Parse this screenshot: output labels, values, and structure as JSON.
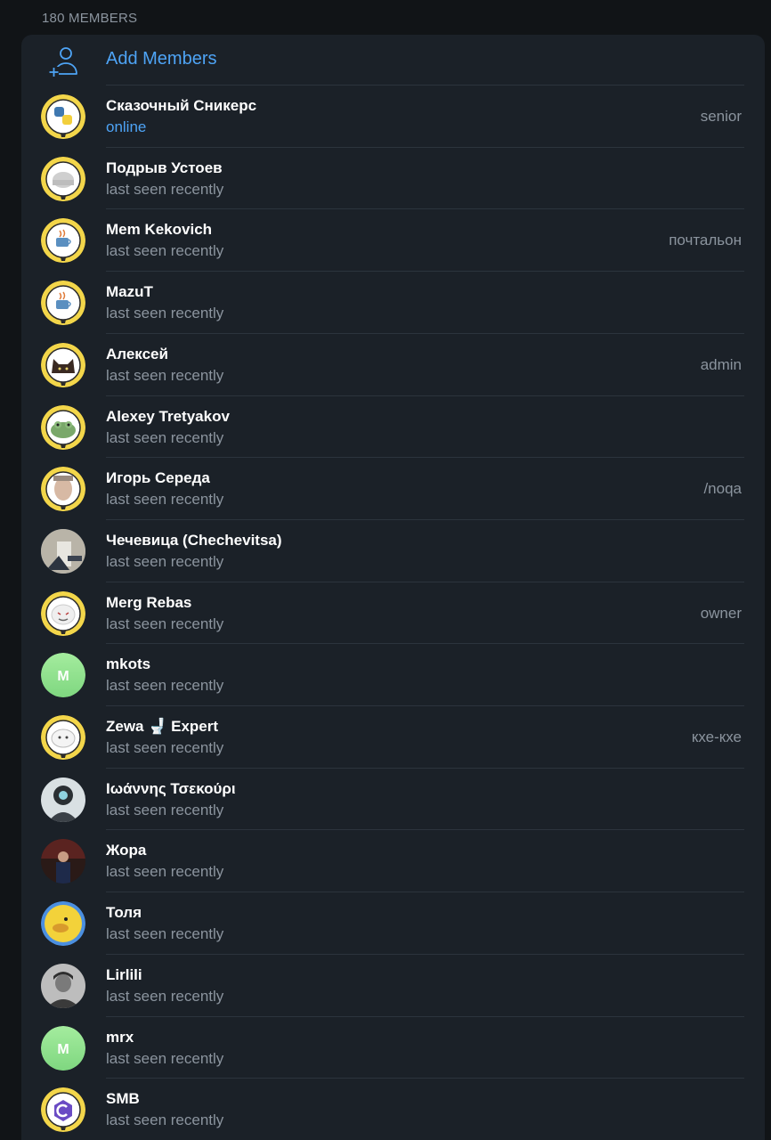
{
  "header": {
    "members_count_label": "180 MEMBERS"
  },
  "add_members": {
    "label": "Add Members",
    "icon": "add-person-icon"
  },
  "colors": {
    "accent": "#4ea4f6",
    "card": "#1b2128",
    "background": "#111417",
    "secondary_text": "#8b949e"
  },
  "members": [
    {
      "name": "Сказочный Сникерс",
      "status": "online",
      "role": "senior",
      "avatar": "python-logo"
    },
    {
      "name": "Подрыв Устоев",
      "status": "last seen recently",
      "role": "",
      "avatar": "yellow-ring"
    },
    {
      "name": "Mem Kekovich",
      "status": "last seen recently",
      "role": "почтальон",
      "avatar": "java-logo"
    },
    {
      "name": "MazuT",
      "status": "last seen recently",
      "role": "",
      "avatar": "java-logo"
    },
    {
      "name": "Алексей",
      "status": "last seen recently",
      "role": "admin",
      "avatar": "cat-photo"
    },
    {
      "name": "Alexey Tretyakov",
      "status": "last seen recently",
      "role": "",
      "avatar": "frog"
    },
    {
      "name": "Игорь Середа",
      "status": "last seen recently",
      "role": "/noqa",
      "avatar": "face-photo"
    },
    {
      "name": "Чечевица (Chechevitsa)",
      "status": "last seen recently",
      "role": "",
      "avatar": "photo"
    },
    {
      "name": "Merg Rebas",
      "status": "last seen recently",
      "role": "owner",
      "avatar": "ghost"
    },
    {
      "name": "mkots",
      "status": "last seen recently",
      "role": "",
      "avatar": "letter-m",
      "initial": "M"
    },
    {
      "name": "Zewa 🚽 Expert",
      "status": "last seen recently",
      "role": "кхе-кхе",
      "avatar": "bubble"
    },
    {
      "name": "Ιωάννης Τσεκούρι",
      "status": "last seen recently",
      "role": "",
      "avatar": "astronaut"
    },
    {
      "name": "Жора",
      "status": "last seen recently",
      "role": "",
      "avatar": "dark-photo"
    },
    {
      "name": "Толя",
      "status": "last seen recently",
      "role": "",
      "avatar": "duck"
    },
    {
      "name": "Lirlili",
      "status": "last seen recently",
      "role": "",
      "avatar": "gray-photo"
    },
    {
      "name": "mrx",
      "status": "last seen recently",
      "role": "",
      "avatar": "letter-m",
      "initial": "M"
    },
    {
      "name": "SMB",
      "status": "last seen recently",
      "role": "",
      "avatar": "c-logo"
    }
  ]
}
